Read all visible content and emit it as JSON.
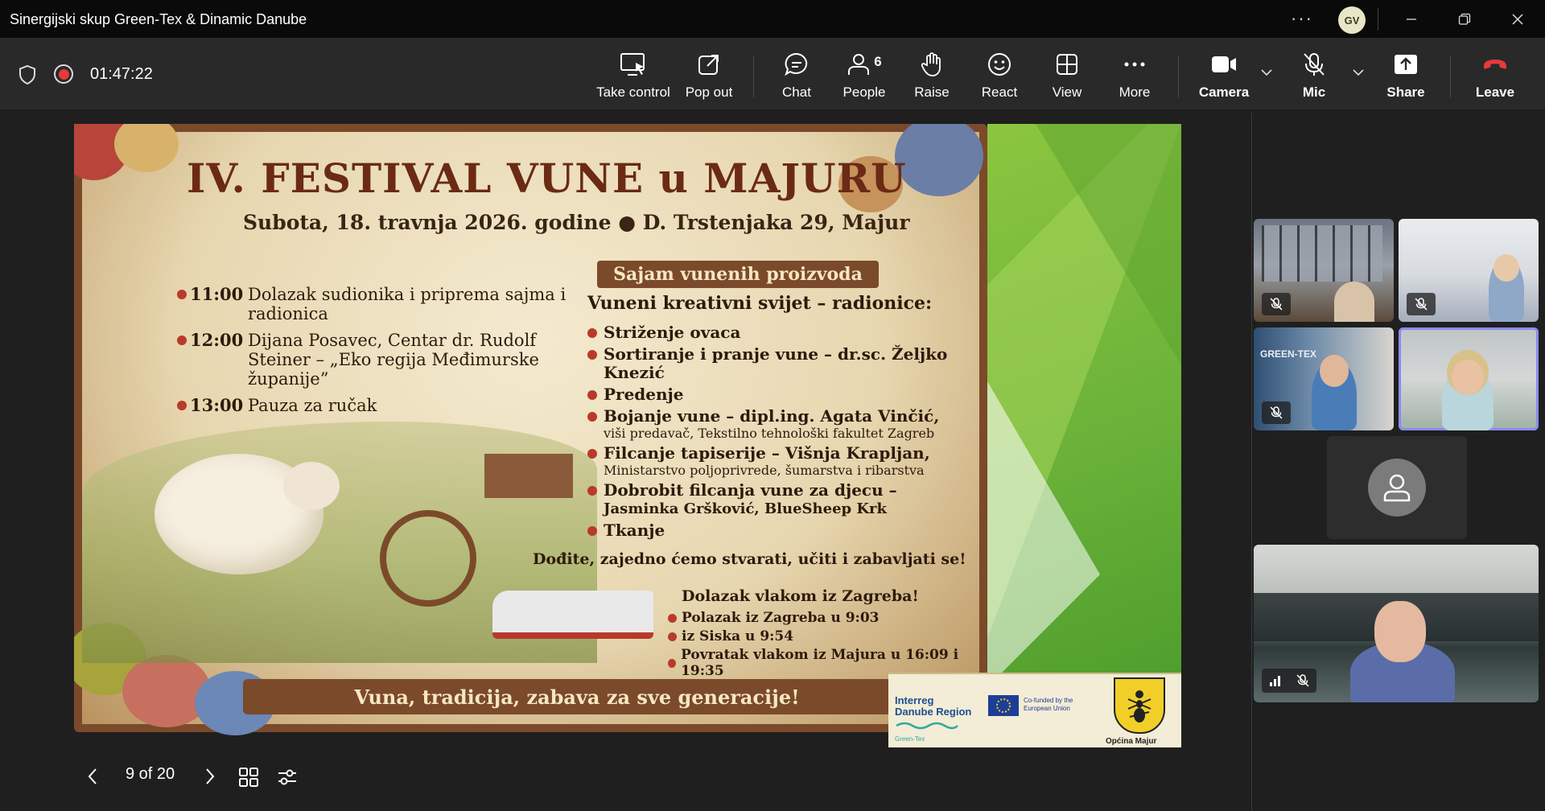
{
  "window": {
    "title": "Sinergijski skup Green-Tex & Dinamic Danube",
    "user_initials": "GV"
  },
  "toolbar": {
    "timer": "01:47:22",
    "take_control": "Take control",
    "pop_out": "Pop out",
    "chat": "Chat",
    "people": "People",
    "people_count": "6",
    "raise": "Raise",
    "react": "React",
    "view": "View",
    "more": "More",
    "camera": "Camera",
    "mic": "Mic",
    "share": "Share",
    "leave": "Leave"
  },
  "slide": {
    "title": "IV. FESTIVAL VUNE u MAJURU",
    "subtitle": "Subota, 18. travnja 2026. godine ● D. Trstenjaka 29, Majur",
    "schedule": [
      {
        "time": "11:00",
        "text": "Dolazak sudionika i priprema sajma i radionica"
      },
      {
        "time": "12:00",
        "text": "Dijana Posavec, Centar dr. Rudolf Steiner – „Eko regija Međimurske županije”"
      },
      {
        "time": "13:00",
        "text": "Pauza za ručak"
      }
    ],
    "banner": "Sajam vunenih proizvoda",
    "workshops_heading": "Vuneni kreativni svijet – radionice:",
    "workshops": [
      {
        "title": "Striženje ovaca",
        "sub": ""
      },
      {
        "title": "Sortiranje i pranje vune – dr.sc. Željko Knezić",
        "sub": ""
      },
      {
        "title": "Predenje",
        "sub": ""
      },
      {
        "title": "Bojanje vune – dipl.ing. Agata Vinčić,",
        "sub": "viši predavač, Tekstilno tehnološki fakultet Zagreb"
      },
      {
        "title": "Filcanje tapiserije – Višnja Krapljan,",
        "sub": "Ministarstvo poljoprivrede, šumarstva i ribarstva"
      },
      {
        "title": "Dobrobit filcanja vune za djecu –",
        "sub": "Jasminka Gršković, BlueSheep Krk"
      },
      {
        "title": "Tkanje",
        "sub": ""
      }
    ],
    "invite": "Dođite, zajedno ćemo stvarati, učiti i zabavljati se!",
    "train_heading": "Dolazak vlakom iz Zagreba!",
    "train": [
      "Polazak iz Zagreba u 9:03",
      "iz Siska u 9:54",
      "Povratak vlakom iz Majura u 16:09 i 19:35"
    ],
    "footer": "Vuna, tradicija, zabava za sve generacije!",
    "logo_interreg_1": "Interreg",
    "logo_interreg_2": "Danube Region",
    "logo_greentex": "Green-Tex",
    "logo_eu": "Co-funded by the European Union",
    "logo_opcina": "Općina Majur"
  },
  "slide_nav": {
    "pager": "9 of 20"
  },
  "gallery": {
    "tile_banner_text": "GREEN-TEX"
  }
}
